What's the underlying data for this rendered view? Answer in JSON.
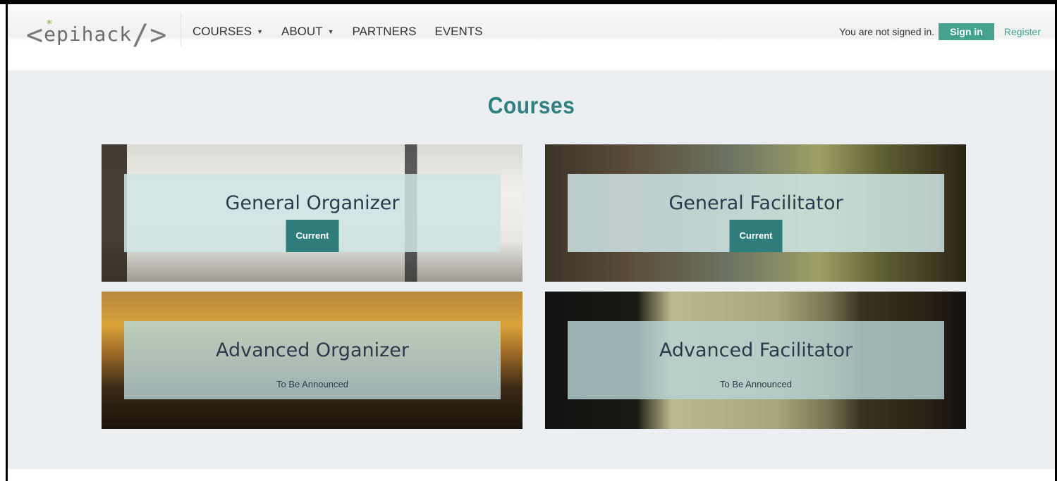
{
  "brand": {
    "logo_text": "epihack",
    "logo_star": "*",
    "logo_left": "<",
    "logo_right": "/>"
  },
  "nav": {
    "items": [
      {
        "label": "COURSES",
        "dropdown": true
      },
      {
        "label": "ABOUT",
        "dropdown": true
      },
      {
        "label": "PARTNERS",
        "dropdown": false
      },
      {
        "label": "EVENTS",
        "dropdown": false
      }
    ],
    "caret": "▼"
  },
  "auth": {
    "status_text": "You are not signed in.",
    "signin_label": "Sign in",
    "register_label": "Register"
  },
  "page": {
    "title": "Courses"
  },
  "courses": [
    {
      "title": "General Organizer",
      "badge": "Current"
    },
    {
      "title": "General Facilitator",
      "badge": "Current"
    },
    {
      "title": "Advanced Organizer",
      "status": "To Be Announced"
    },
    {
      "title": "Advanced Facilitator",
      "status": "To Be Announced"
    }
  ],
  "colors": {
    "accent": "#43a38f",
    "title": "#2f8080",
    "badge": "#2f7c7c"
  }
}
